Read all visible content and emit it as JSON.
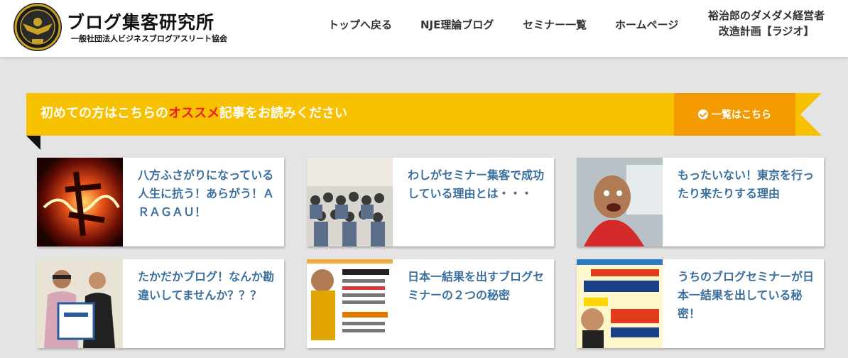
{
  "header": {
    "logo_title": "ブログ集客研究所",
    "logo_subtitle": "一般社団法人ビジネスブログアスリート協会",
    "nav": [
      {
        "label": "トップへ戻る"
      },
      {
        "label": "NJE理論ブログ"
      },
      {
        "label": "セミナー一覧"
      },
      {
        "label": "ホームページ"
      },
      {
        "line1": "裕治郎のダメダメ経営者",
        "line2": "改造計画【ラジオ】"
      }
    ]
  },
  "banner": {
    "text_before": "初めての方はこちらの",
    "text_highlight": "オススメ",
    "text_after": "記事をお読みください",
    "button_label": "一覧はこちら"
  },
  "articles": [
    {
      "title": "八方ふさがりになっている人生に抗う！あらがう！ＡＲＡＧＡＵ！"
    },
    {
      "title": "わしがセミナー集客で成功している理由とは・・・"
    },
    {
      "title": "もったいない！東京を行ったり来たりする理由"
    },
    {
      "title": "たかだかブログ！なんか勘違いしてませんか？？？"
    },
    {
      "title": "日本一結果を出すブログセミナーの２つの秘密"
    },
    {
      "title": "うちのブログセミナーが日本一結果を出している秘密！"
    }
  ],
  "colors": {
    "banner_yellow": "#f7c100",
    "button_orange": "#f39a00",
    "highlight_red": "#ee1d23",
    "link_blue": "#3a6f9e"
  }
}
